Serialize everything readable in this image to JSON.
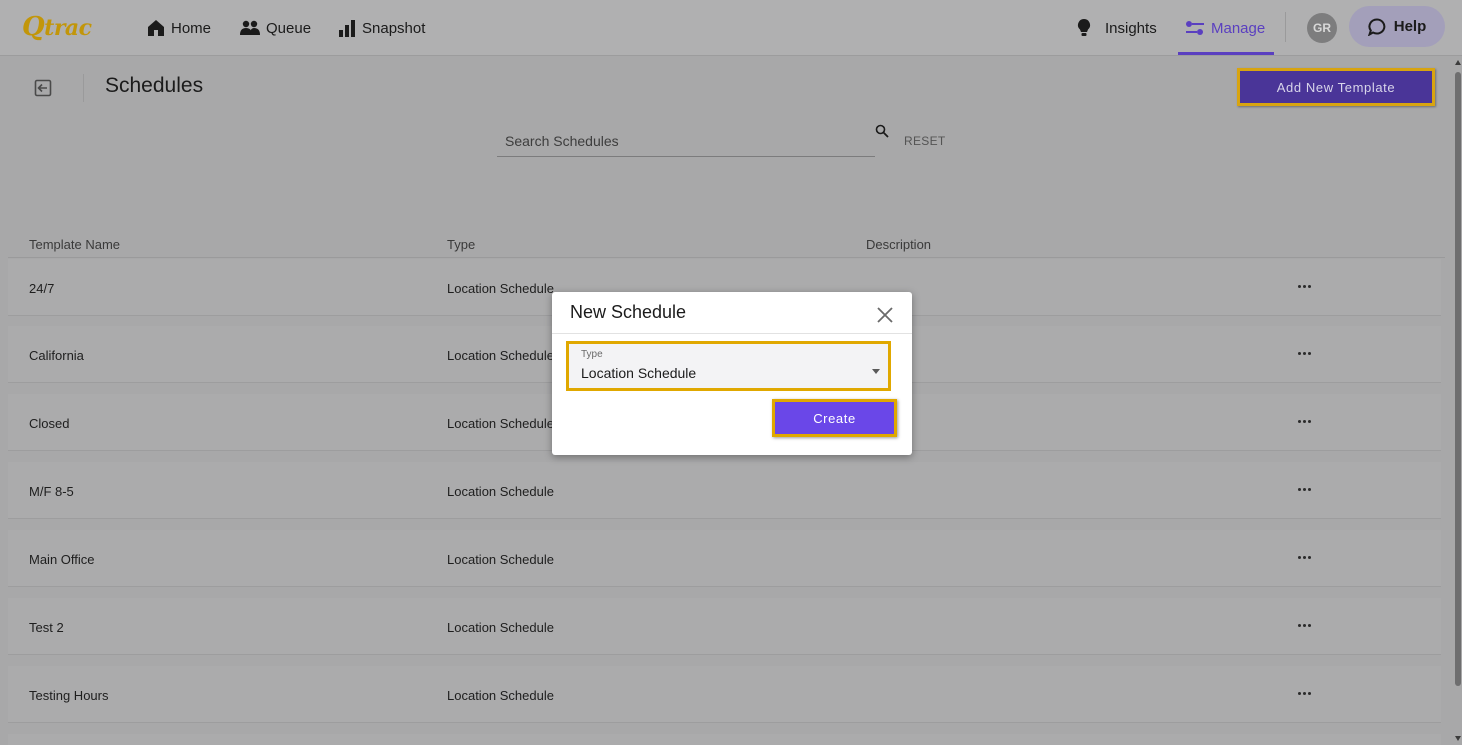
{
  "app": {
    "logo_text": "Qtrac"
  },
  "nav": {
    "home": "Home",
    "queue": "Queue",
    "snapshot": "Snapshot",
    "insights": "Insights",
    "manage": "Manage",
    "avatar_initials": "GR",
    "help": "Help",
    "active": "Manage",
    "accent_color": "#5a3fc0"
  },
  "header": {
    "title": "Schedules",
    "add_button": "Add New Template"
  },
  "search": {
    "placeholder": "Search Schedules",
    "value": "",
    "reset": "RESET"
  },
  "table": {
    "columns": [
      "Template Name",
      "Type",
      "Description"
    ],
    "rows": [
      {
        "name": "24/7",
        "type": "Location Schedule",
        "description": ""
      },
      {
        "name": "California",
        "type": "Location Schedule",
        "description": ""
      },
      {
        "name": "Closed",
        "type": "Location Schedule",
        "description": ""
      },
      {
        "name": "M/F 8-5",
        "type": "Location Schedule",
        "description": ""
      },
      {
        "name": "Main Office",
        "type": "Location Schedule",
        "description": ""
      },
      {
        "name": "Test 2",
        "type": "Location Schedule",
        "description": ""
      },
      {
        "name": "Testing Hours",
        "type": "Location Schedule",
        "description": ""
      }
    ]
  },
  "modal": {
    "title": "New Schedule",
    "type_label": "Type",
    "type_value": "Location Schedule",
    "create_button": "Create",
    "highlight_color": "#e0a800"
  }
}
